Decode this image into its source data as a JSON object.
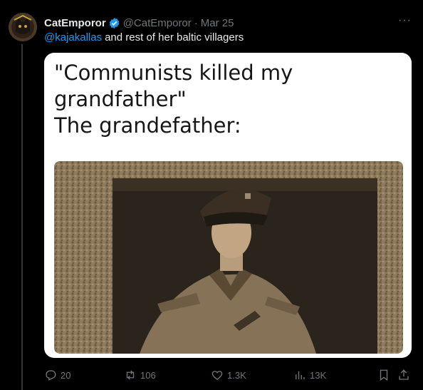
{
  "post": {
    "display_name": "CatEmporor",
    "handle": "@CatEmporor",
    "separator": "·",
    "date": "Mar 25",
    "more_icon": "more-horizontal-icon",
    "mention": "@kajakallas",
    "text": "and rest of her baltic villagers"
  },
  "media": {
    "caption_line_1": "\"Communists killed my",
    "caption_line_2": "grandfather\"",
    "caption_line_3": "The grandefather:"
  },
  "actions": {
    "reply_count": "20",
    "repost_count": "106",
    "like_count": "1.3K",
    "views_count": "13K"
  },
  "colors": {
    "background": "#000000",
    "text_primary": "#e7e9ea",
    "text_secondary": "#71767b",
    "accent": "#1d9bf0"
  }
}
